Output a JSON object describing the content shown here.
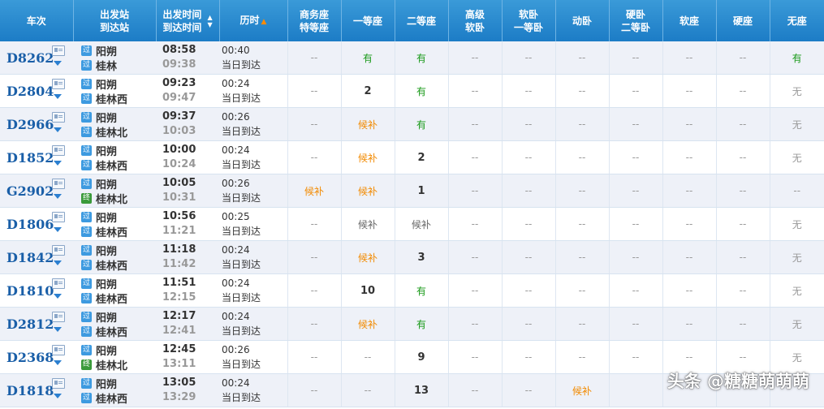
{
  "header": {
    "columns": [
      {
        "key": "train",
        "line1": "车次"
      },
      {
        "key": "station",
        "line1": "出发站",
        "line2": "到达站"
      },
      {
        "key": "time",
        "line1": "出发时间",
        "line2": "到达时间"
      },
      {
        "key": "duration",
        "line1": "历时"
      },
      {
        "key": "business",
        "line1": "商务座",
        "line2": "特等座"
      },
      {
        "key": "first",
        "line1": "一等座"
      },
      {
        "key": "second",
        "line1": "二等座"
      },
      {
        "key": "premium_soft",
        "line1": "高级",
        "line2": "软卧"
      },
      {
        "key": "soft_first",
        "line1": "软卧",
        "line2": "一等卧"
      },
      {
        "key": "dong",
        "line1": "动卧"
      },
      {
        "key": "hard_second",
        "line1": "硬卧",
        "line2": "二等卧"
      },
      {
        "key": "soft_seat",
        "line1": "软座"
      },
      {
        "key": "hard_seat",
        "line1": "硬座"
      },
      {
        "key": "standing",
        "line1": "无座"
      }
    ]
  },
  "badges": {
    "pass": "过",
    "end": "终"
  },
  "rows": [
    {
      "train": "D8262",
      "from": "阳朔",
      "to": "桂林",
      "to_badge": "pass",
      "dep": "08:58",
      "arr": "09:38",
      "dur": "00:40",
      "note": "当日到达",
      "seats": [
        [
          "--",
          "none"
        ],
        [
          "有",
          "have"
        ],
        [
          "有",
          "have"
        ],
        [
          "--",
          "none"
        ],
        [
          "--",
          "none"
        ],
        [
          "--",
          "none"
        ],
        [
          "--",
          "none"
        ],
        [
          "--",
          "none"
        ],
        [
          "--",
          "none"
        ],
        [
          "有",
          "have"
        ]
      ]
    },
    {
      "train": "D2804",
      "from": "阳朔",
      "to": "桂林西",
      "to_badge": "pass",
      "dep": "09:23",
      "arr": "09:47",
      "dur": "00:24",
      "note": "当日到达",
      "seats": [
        [
          "--",
          "none"
        ],
        [
          "2",
          "num"
        ],
        [
          "有",
          "have"
        ],
        [
          "--",
          "none"
        ],
        [
          "--",
          "none"
        ],
        [
          "--",
          "none"
        ],
        [
          "--",
          "none"
        ],
        [
          "--",
          "none"
        ],
        [
          "--",
          "none"
        ],
        [
          "无",
          "no"
        ]
      ]
    },
    {
      "train": "D2966",
      "from": "阳朔",
      "to": "桂林北",
      "to_badge": "pass",
      "dep": "09:37",
      "arr": "10:03",
      "dur": "00:26",
      "note": "当日到达",
      "seats": [
        [
          "--",
          "none"
        ],
        [
          "候补",
          "wait"
        ],
        [
          "有",
          "have"
        ],
        [
          "--",
          "none"
        ],
        [
          "--",
          "none"
        ],
        [
          "--",
          "none"
        ],
        [
          "--",
          "none"
        ],
        [
          "--",
          "none"
        ],
        [
          "--",
          "none"
        ],
        [
          "无",
          "no"
        ]
      ]
    },
    {
      "train": "D1852",
      "from": "阳朔",
      "to": "桂林西",
      "to_badge": "pass",
      "dep": "10:00",
      "arr": "10:24",
      "dur": "00:24",
      "note": "当日到达",
      "seats": [
        [
          "--",
          "none"
        ],
        [
          "候补",
          "wait"
        ],
        [
          "2",
          "num"
        ],
        [
          "--",
          "none"
        ],
        [
          "--",
          "none"
        ],
        [
          "--",
          "none"
        ],
        [
          "--",
          "none"
        ],
        [
          "--",
          "none"
        ],
        [
          "--",
          "none"
        ],
        [
          "无",
          "no"
        ]
      ]
    },
    {
      "train": "G2902",
      "from": "阳朔",
      "to": "桂林北",
      "to_badge": "end",
      "dep": "10:05",
      "arr": "10:31",
      "dur": "00:26",
      "note": "当日到达",
      "seats": [
        [
          "候补",
          "wait"
        ],
        [
          "候补",
          "wait"
        ],
        [
          "1",
          "num"
        ],
        [
          "--",
          "none"
        ],
        [
          "--",
          "none"
        ],
        [
          "--",
          "none"
        ],
        [
          "--",
          "none"
        ],
        [
          "--",
          "none"
        ],
        [
          "--",
          "none"
        ],
        [
          "--",
          "none"
        ]
      ]
    },
    {
      "train": "D1806",
      "from": "阳朔",
      "to": "桂林西",
      "to_badge": "pass",
      "dep": "10:56",
      "arr": "11:21",
      "dur": "00:25",
      "note": "当日到达",
      "seats": [
        [
          "--",
          "none"
        ],
        [
          "候补",
          "waitgray"
        ],
        [
          "候补",
          "waitgray"
        ],
        [
          "--",
          "none"
        ],
        [
          "--",
          "none"
        ],
        [
          "--",
          "none"
        ],
        [
          "--",
          "none"
        ],
        [
          "--",
          "none"
        ],
        [
          "--",
          "none"
        ],
        [
          "无",
          "no"
        ]
      ]
    },
    {
      "train": "D1842",
      "from": "阳朔",
      "to": "桂林西",
      "to_badge": "pass",
      "dep": "11:18",
      "arr": "11:42",
      "dur": "00:24",
      "note": "当日到达",
      "seats": [
        [
          "--",
          "none"
        ],
        [
          "候补",
          "wait"
        ],
        [
          "3",
          "num"
        ],
        [
          "--",
          "none"
        ],
        [
          "--",
          "none"
        ],
        [
          "--",
          "none"
        ],
        [
          "--",
          "none"
        ],
        [
          "--",
          "none"
        ],
        [
          "--",
          "none"
        ],
        [
          "无",
          "no"
        ]
      ]
    },
    {
      "train": "D1810",
      "from": "阳朔",
      "to": "桂林西",
      "to_badge": "pass",
      "dep": "11:51",
      "arr": "12:15",
      "dur": "00:24",
      "note": "当日到达",
      "seats": [
        [
          "--",
          "none"
        ],
        [
          "10",
          "num"
        ],
        [
          "有",
          "have"
        ],
        [
          "--",
          "none"
        ],
        [
          "--",
          "none"
        ],
        [
          "--",
          "none"
        ],
        [
          "--",
          "none"
        ],
        [
          "--",
          "none"
        ],
        [
          "--",
          "none"
        ],
        [
          "无",
          "no"
        ]
      ]
    },
    {
      "train": "D2812",
      "from": "阳朔",
      "to": "桂林西",
      "to_badge": "pass",
      "dep": "12:17",
      "arr": "12:41",
      "dur": "00:24",
      "note": "当日到达",
      "seats": [
        [
          "--",
          "none"
        ],
        [
          "候补",
          "wait"
        ],
        [
          "有",
          "have"
        ],
        [
          "--",
          "none"
        ],
        [
          "--",
          "none"
        ],
        [
          "--",
          "none"
        ],
        [
          "--",
          "none"
        ],
        [
          "--",
          "none"
        ],
        [
          "--",
          "none"
        ],
        [
          "无",
          "no"
        ]
      ]
    },
    {
      "train": "D2368",
      "from": "阳朔",
      "to": "桂林北",
      "to_badge": "end",
      "dep": "12:45",
      "arr": "13:11",
      "dur": "00:26",
      "note": "当日到达",
      "seats": [
        [
          "--",
          "none"
        ],
        [
          "--",
          "none"
        ],
        [
          "9",
          "num"
        ],
        [
          "--",
          "none"
        ],
        [
          "--",
          "none"
        ],
        [
          "--",
          "none"
        ],
        [
          "--",
          "none"
        ],
        [
          "--",
          "none"
        ],
        [
          "--",
          "none"
        ],
        [
          "无",
          "no"
        ]
      ]
    },
    {
      "train": "D1818",
      "from": "阳朔",
      "to": "桂林西",
      "to_badge": "pass",
      "dep": "13:05",
      "arr": "13:29",
      "dur": "00:24",
      "note": "当日到达",
      "seats": [
        [
          "--",
          "none"
        ],
        [
          "--",
          "none"
        ],
        [
          "13",
          "num"
        ],
        [
          "--",
          "none"
        ],
        [
          "--",
          "none"
        ],
        [
          "候补",
          "wait"
        ],
        [
          "",
          "none"
        ],
        [
          "",
          "none"
        ],
        [
          "",
          "none"
        ],
        [
          "",
          "none"
        ]
      ]
    }
  ],
  "watermark": "头条 @糖糖萌萌萌"
}
